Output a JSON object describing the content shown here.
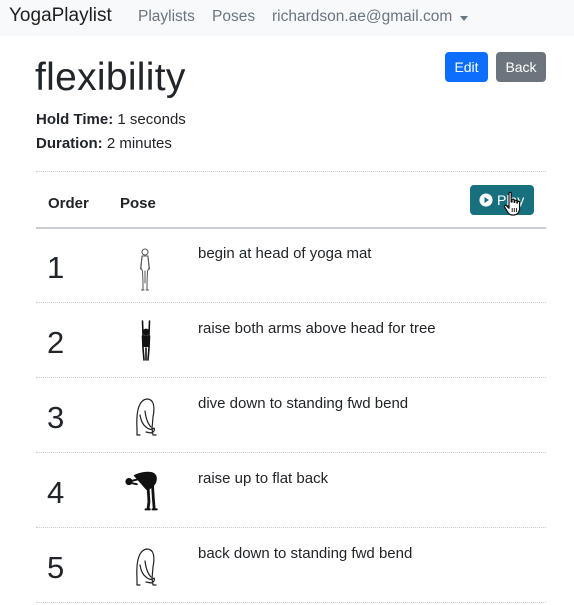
{
  "nav": {
    "brand": "YogaPlaylist",
    "links": [
      "Playlists",
      "Poses"
    ],
    "user_email": "richardson.ae@gmail.com"
  },
  "page": {
    "title": "flexibility",
    "edit_label": "Edit",
    "back_label": "Back",
    "hold_label": "Hold Time:",
    "hold_value": "1 seconds",
    "duration_label": "Duration:",
    "duration_value": "2 minutes"
  },
  "table": {
    "headers": [
      "Order",
      "Pose"
    ],
    "play_label": "Play",
    "rows": [
      {
        "order": "1",
        "pose_icon": "standing-mountain-pose-icon",
        "description": "begin at head of yoga mat"
      },
      {
        "order": "2",
        "pose_icon": "tree-arms-up-pose-icon",
        "description": "raise both arms above head for tree"
      },
      {
        "order": "3",
        "pose_icon": "forward-bend-pose-icon",
        "description": "dive down to standing fwd bend"
      },
      {
        "order": "4",
        "pose_icon": "flat-back-pose-icon",
        "description": "raise up to flat back"
      },
      {
        "order": "5",
        "pose_icon": "forward-bend-pose-icon",
        "description": "back down to standing fwd bend"
      }
    ]
  },
  "colors": {
    "primary": "#0d6efd",
    "secondary": "#6c757d",
    "play": "#16707e",
    "navbar_bg": "#f8f9fa"
  }
}
